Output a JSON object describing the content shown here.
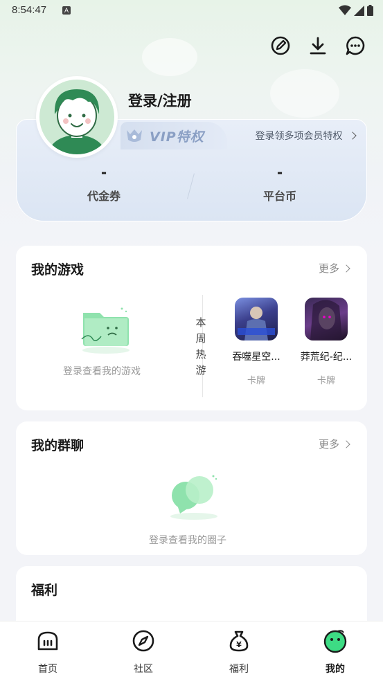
{
  "status_bar": {
    "time": "8:54:47",
    "badge": "A"
  },
  "header": {
    "actions": [
      {
        "icon": "edit-icon"
      },
      {
        "icon": "download-icon"
      },
      {
        "icon": "message-icon"
      }
    ]
  },
  "profile": {
    "login_label": "登录/注册",
    "avatar_icon": "avatar-icon"
  },
  "vip": {
    "badge": "VIP特权",
    "link": "登录领多项会员特权",
    "stats": [
      {
        "value": "-",
        "label": "代金券"
      },
      {
        "value": "-",
        "label": "平台币"
      }
    ]
  },
  "my_games": {
    "title": "我的游戏",
    "more": "更多",
    "empty": "登录查看我的游戏",
    "hot_label": [
      "本",
      "周",
      "热",
      "游"
    ],
    "games": [
      {
        "name": "吞噬星空...",
        "tag": "卡牌"
      },
      {
        "name": "莽荒纪-纪...",
        "tag": "卡牌"
      }
    ]
  },
  "my_groups": {
    "title": "我的群聊",
    "more": "更多",
    "empty": "登录查看我的圈子"
  },
  "welfare": {
    "title": "福利"
  },
  "bottom_nav": {
    "items": [
      {
        "label": "首页",
        "icon": "home-icon"
      },
      {
        "label": "社区",
        "icon": "compass-icon"
      },
      {
        "label": "福利",
        "icon": "money-bag-icon"
      },
      {
        "label": "我的",
        "icon": "profile-face-icon"
      }
    ],
    "active_index": 3
  },
  "colors": {
    "accent": "#3ddc84",
    "vip_text": "#8a9fc4",
    "card_bg": "#ffffff",
    "page_bg": "#f3f4f8"
  }
}
